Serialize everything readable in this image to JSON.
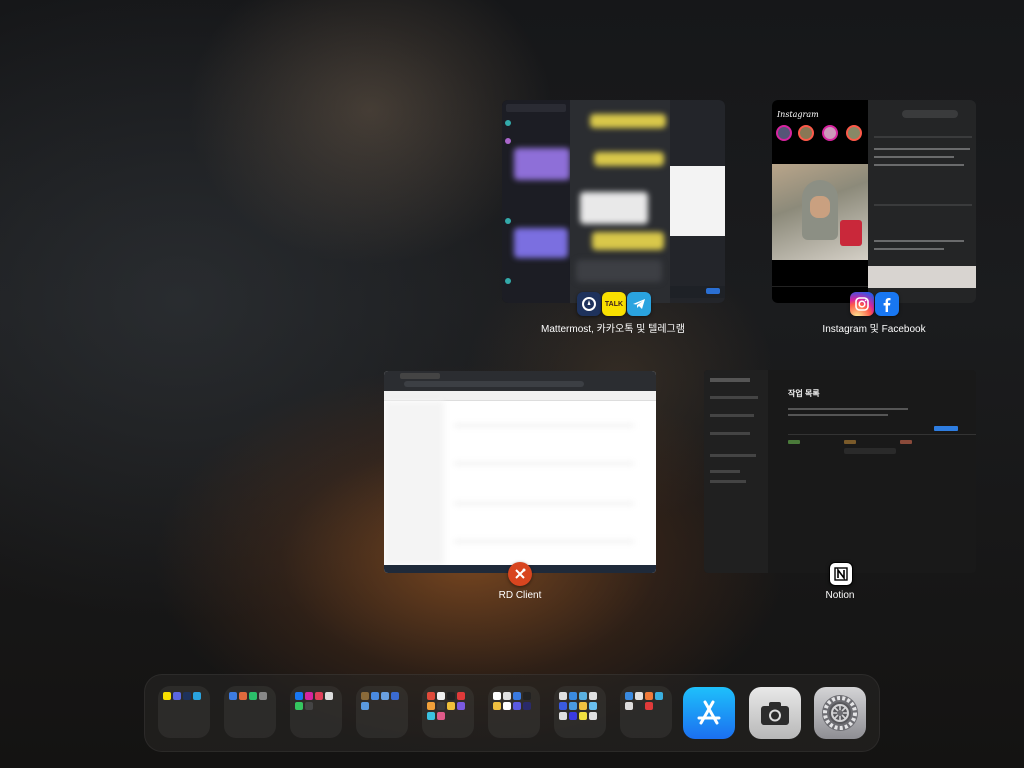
{
  "app_switcher": {
    "cards": [
      {
        "id": "chat-group",
        "label": "Mattermost, 카카오톡 및 텔레그램",
        "icons": [
          "mattermost-icon",
          "kakaotalk-icon",
          "telegram-icon"
        ],
        "talk_text": "TALK"
      },
      {
        "id": "social-group",
        "label": "Instagram 및 Facebook",
        "icons": [
          "instagram-icon",
          "facebook-icon"
        ],
        "instagram_logo_text": "Instagram"
      },
      {
        "id": "rd-client",
        "label": "RD Client",
        "icons": [
          "rd-client-icon"
        ]
      },
      {
        "id": "notion",
        "label": "Notion",
        "icons": [
          "notion-icon"
        ],
        "page_title": "작업 목록"
      }
    ]
  },
  "dock": {
    "folders": [
      "folder-1",
      "folder-2",
      "folder-3",
      "folder-4",
      "folder-5",
      "folder-6",
      "folder-7",
      "folder-8"
    ],
    "apps": [
      {
        "name": "app-store",
        "icon": "app-store-icon"
      },
      {
        "name": "camera",
        "icon": "camera-icon"
      },
      {
        "name": "settings",
        "icon": "settings-gear-icon"
      }
    ]
  },
  "colors": {
    "mattermost": "#1e325c",
    "kakaotalk": "#f9e000",
    "telegram": "#2aa3df",
    "facebook": "#1877f2",
    "rdclient": "#d8451f",
    "appstore": "#1b8cf5"
  }
}
